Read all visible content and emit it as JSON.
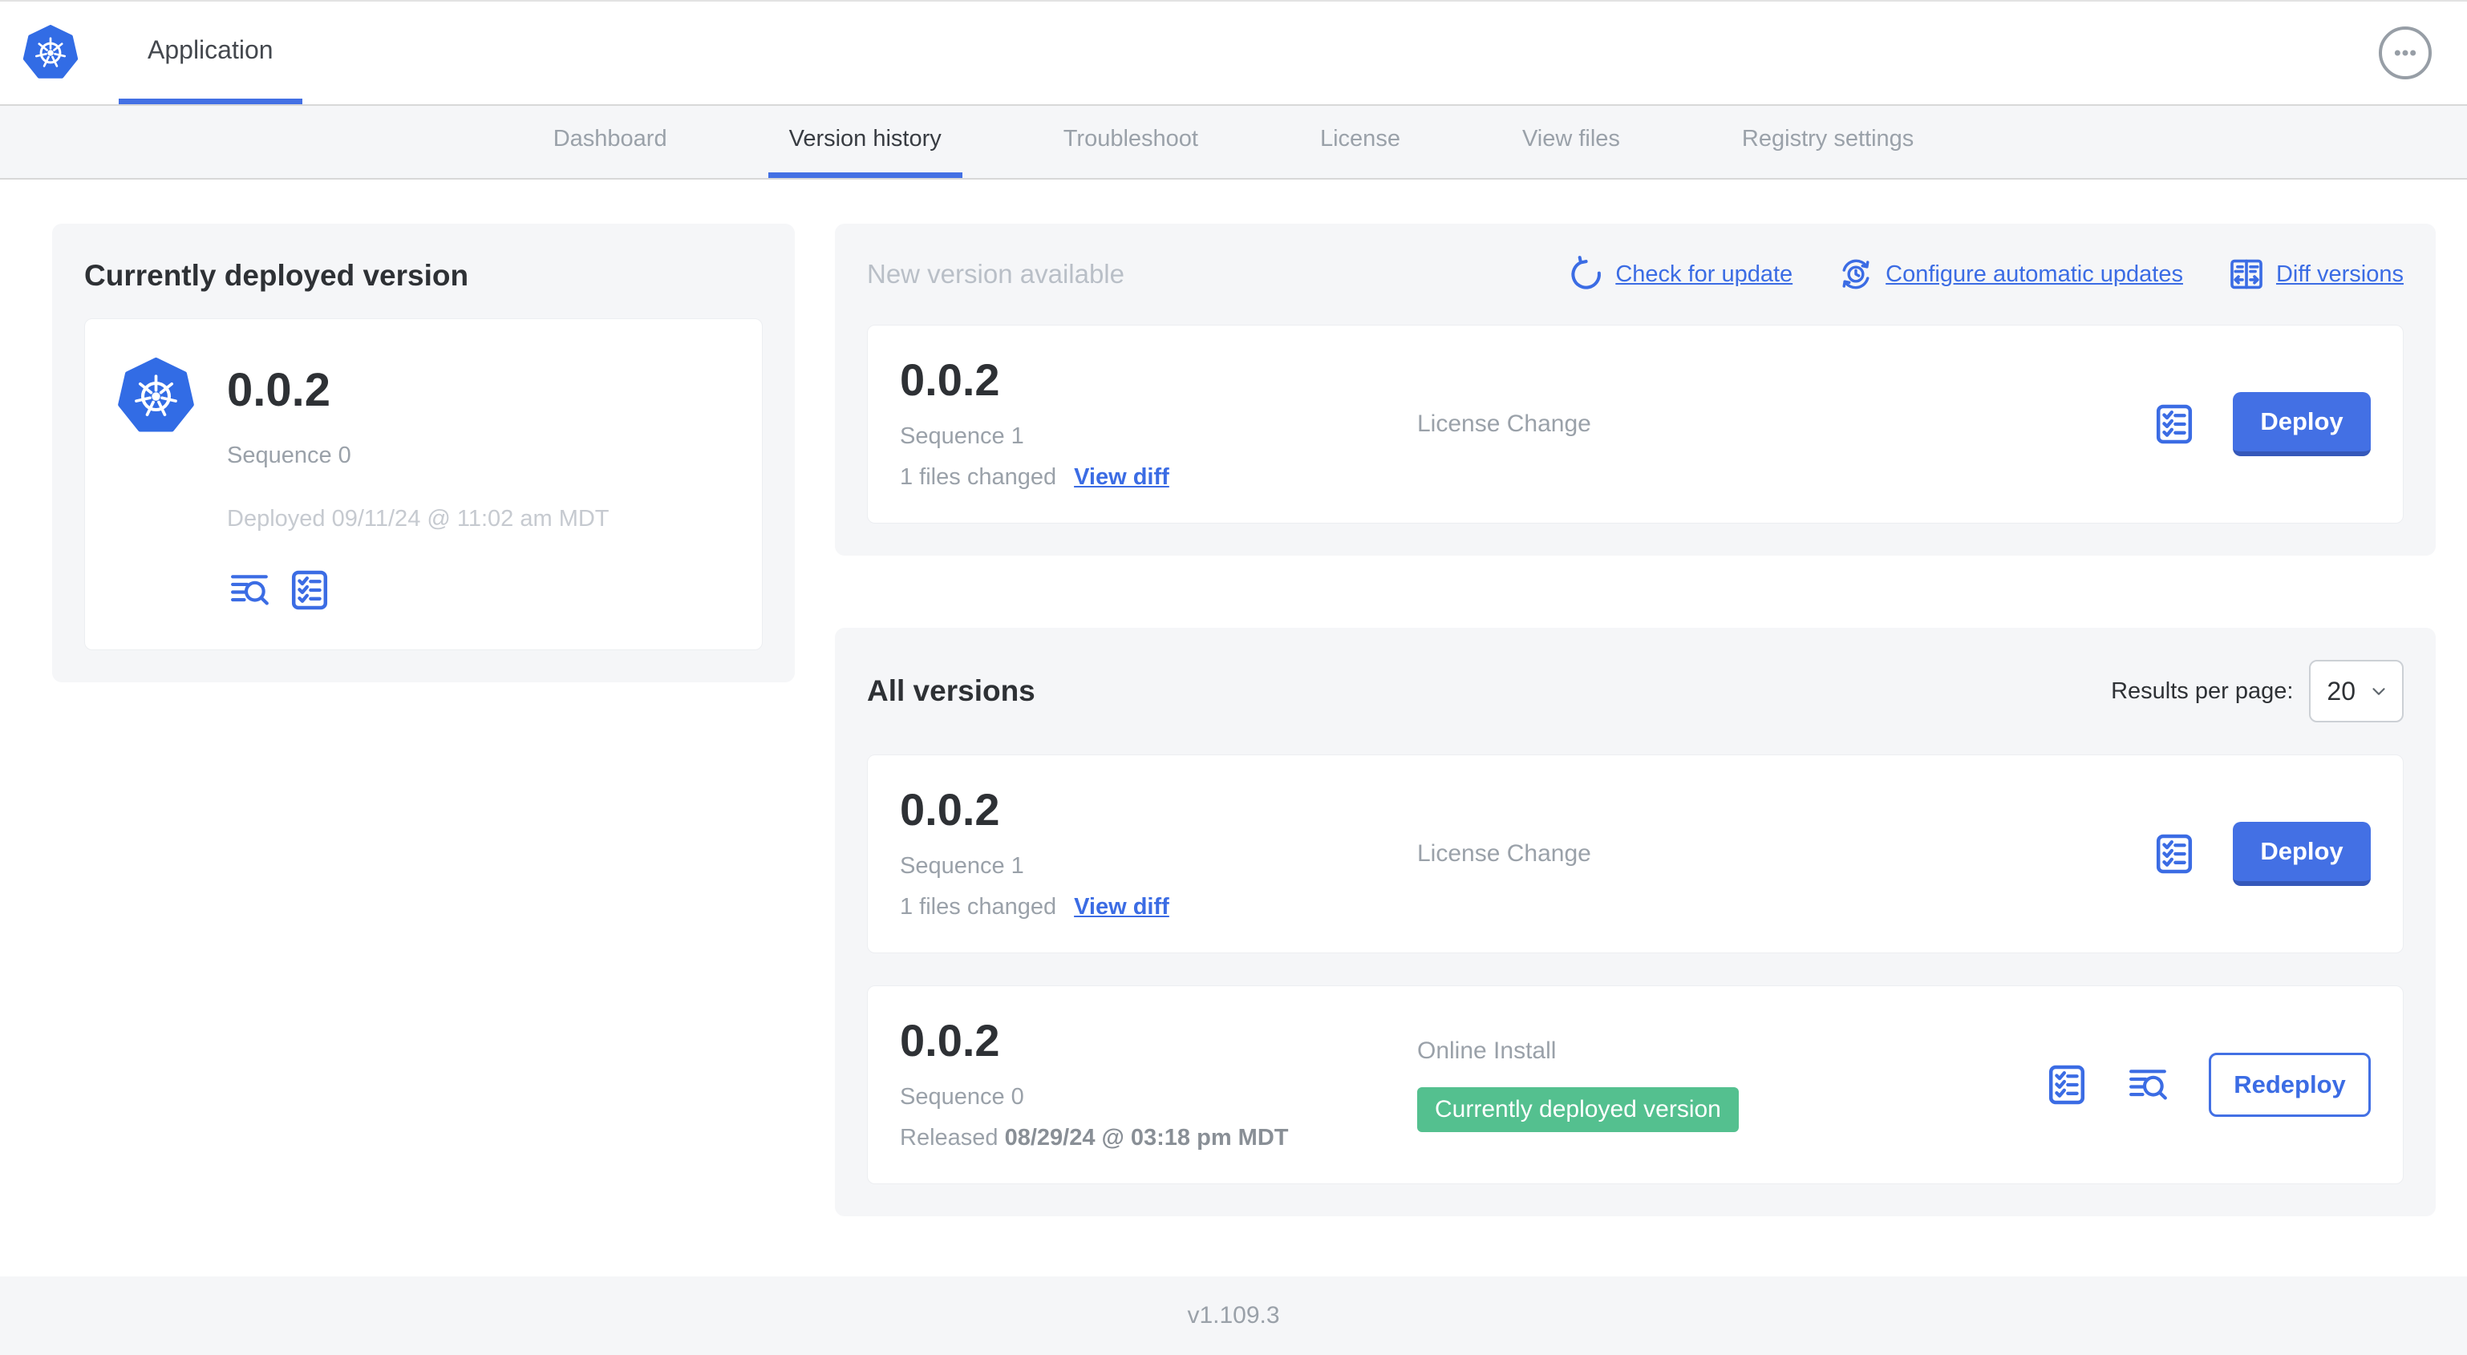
{
  "app": {
    "header": {
      "tab_label": "Application"
    },
    "nav": {
      "tabs": [
        "Dashboard",
        "Version history",
        "Troubleshoot",
        "License",
        "View files",
        "Registry settings"
      ],
      "active_tab": "Version history"
    }
  },
  "current_version_panel": {
    "title": "Currently deployed version",
    "version": "0.0.2",
    "sequence": "Sequence 0",
    "deployed": "Deployed 09/11/24 @ 11:02 am MDT"
  },
  "new_version_panel": {
    "title": "New version available",
    "check_for_update": "Check for update",
    "configure_automatic_updates": "Configure automatic updates",
    "diff_versions": "Diff versions",
    "card": {
      "version": "0.0.2",
      "sequence": "Sequence 1",
      "files_changed": "1 files changed",
      "view_diff": "View diff",
      "release_type": "License Change",
      "deploy_button": "Deploy"
    }
  },
  "all_versions_panel": {
    "title": "All versions",
    "results_per_page_label": "Results per page:",
    "results_per_page_value": "20",
    "rows": [
      {
        "version": "0.0.2",
        "sequence": "Sequence 1",
        "files_changed": "1 files changed",
        "view_diff": "View diff",
        "release_type": "License Change",
        "action_button": "Deploy"
      },
      {
        "version": "0.0.2",
        "sequence": "Sequence 0",
        "released_label": "Released ",
        "released_date": "08/29/24 @ 03:18 pm MDT",
        "release_type": "Online Install",
        "badge": "Currently deployed version",
        "action_button": "Redeploy"
      }
    ]
  },
  "footer": {
    "version": "v1.109.3"
  },
  "colors": {
    "accent_blue": "#3b6ce4",
    "button_blue": "#4370e4",
    "kubernetes_blue": "#326ce5",
    "badge_green": "#54c08f",
    "panel_gray": "#f5f6f8"
  }
}
